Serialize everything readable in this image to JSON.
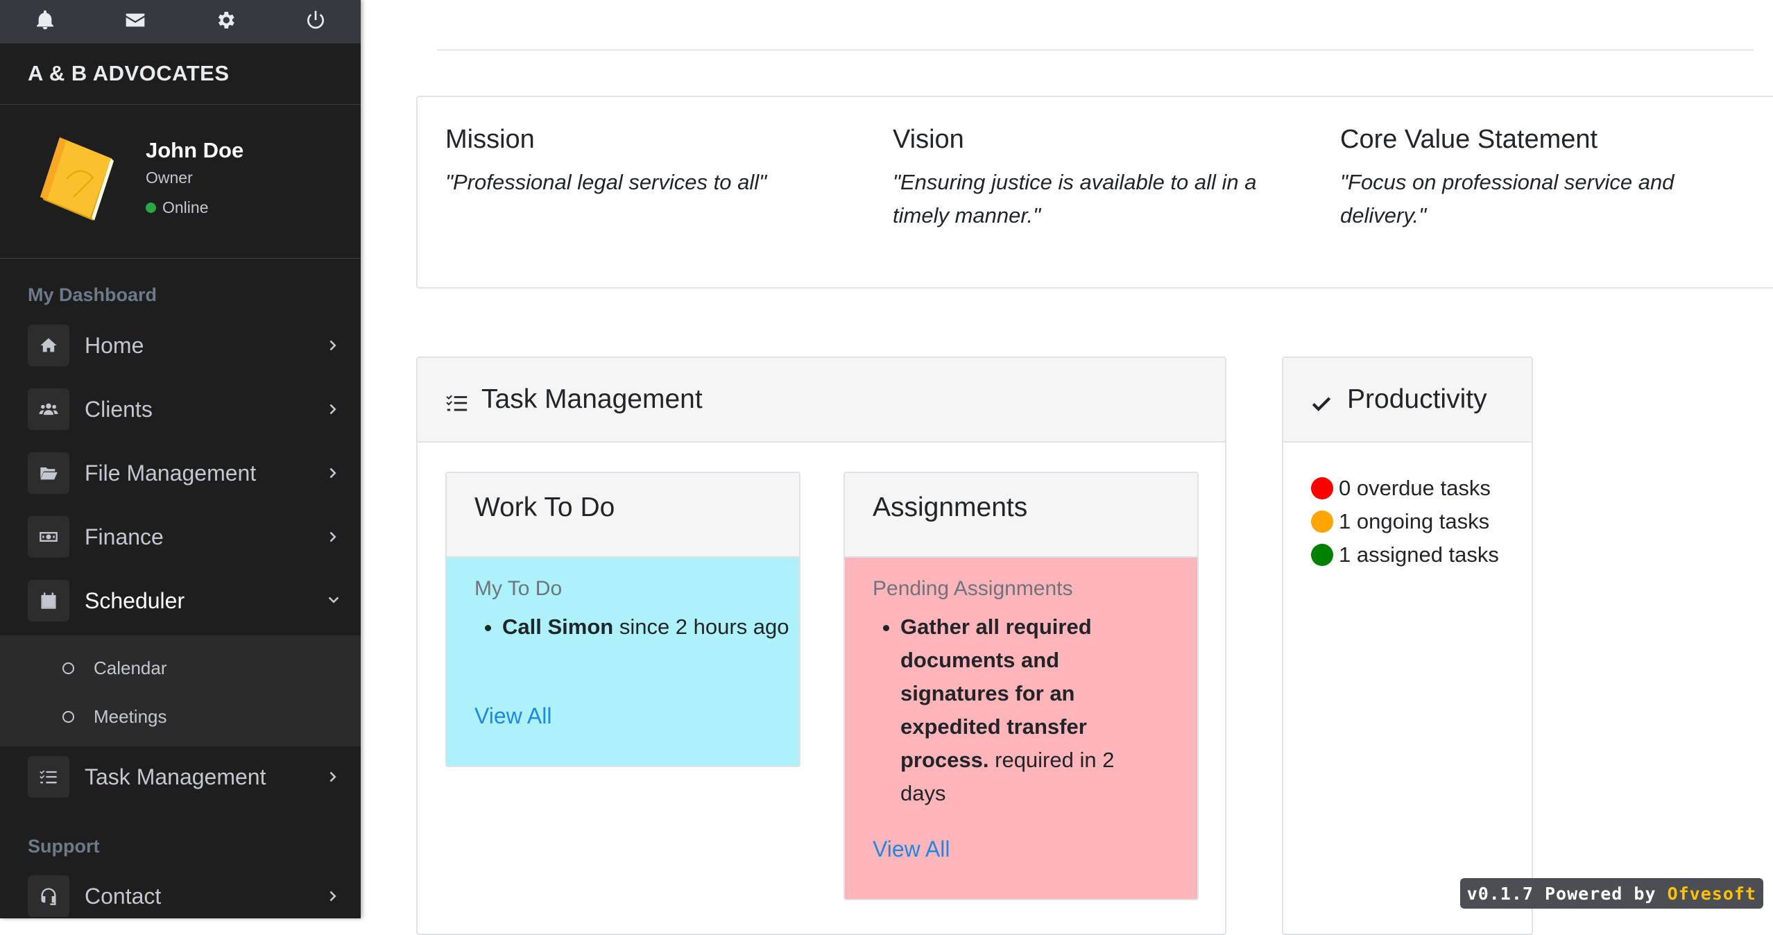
{
  "sidebar": {
    "brand": "A & B ADVOCATES",
    "user": {
      "name": "John Doe",
      "role": "Owner",
      "status": "Online"
    },
    "sections": {
      "dashboard": "My Dashboard",
      "support": "Support"
    },
    "items": {
      "home": "Home",
      "clients": "Clients",
      "files": "File Management",
      "finance": "Finance",
      "scheduler": "Scheduler",
      "tasks": "Task Management",
      "contact": "Contact"
    },
    "scheduler_sub": {
      "calendar": "Calendar",
      "meetings": "Meetings"
    }
  },
  "mission": {
    "mission_title": "Mission",
    "mission_text": "\"Professional legal services to all\"",
    "vision_title": "Vision",
    "vision_text": "\"Ensuring justice is available to all in a timely manner.\"",
    "values_title": "Core Value Statement",
    "values_text": "\"Focus on professional service and delivery.\""
  },
  "tasks": {
    "title": "Task Management",
    "work": {
      "title": "Work To Do",
      "subtitle": "My To Do",
      "item_bold": "Call Simon",
      "item_rest": " since 2 hours ago",
      "link": "View All"
    },
    "assignments": {
      "title": "Assignments",
      "subtitle": "Pending Assignments",
      "item_bold": "Gather all required documents and signatures for an expedited transfer process.",
      "item_rest": " required in 2 days",
      "link": "View All"
    }
  },
  "productivity": {
    "title": "Productivity",
    "overdue": "0 overdue tasks",
    "ongoing": "1 ongoing tasks",
    "assigned": "1 assigned tasks"
  },
  "footer": {
    "version_text": "v0.1.7 Powered by ",
    "brand": "Ofvesoft"
  },
  "colors": {
    "sidebar_bg": "#1e1e1e",
    "todo_bg": "#adf2fb",
    "assignment_bg": "#ffb5b9",
    "link": "#1e88e5",
    "overdue": "#ff0000",
    "ongoing": "#ffa500",
    "assigned": "#008000",
    "online": "#28a745"
  }
}
